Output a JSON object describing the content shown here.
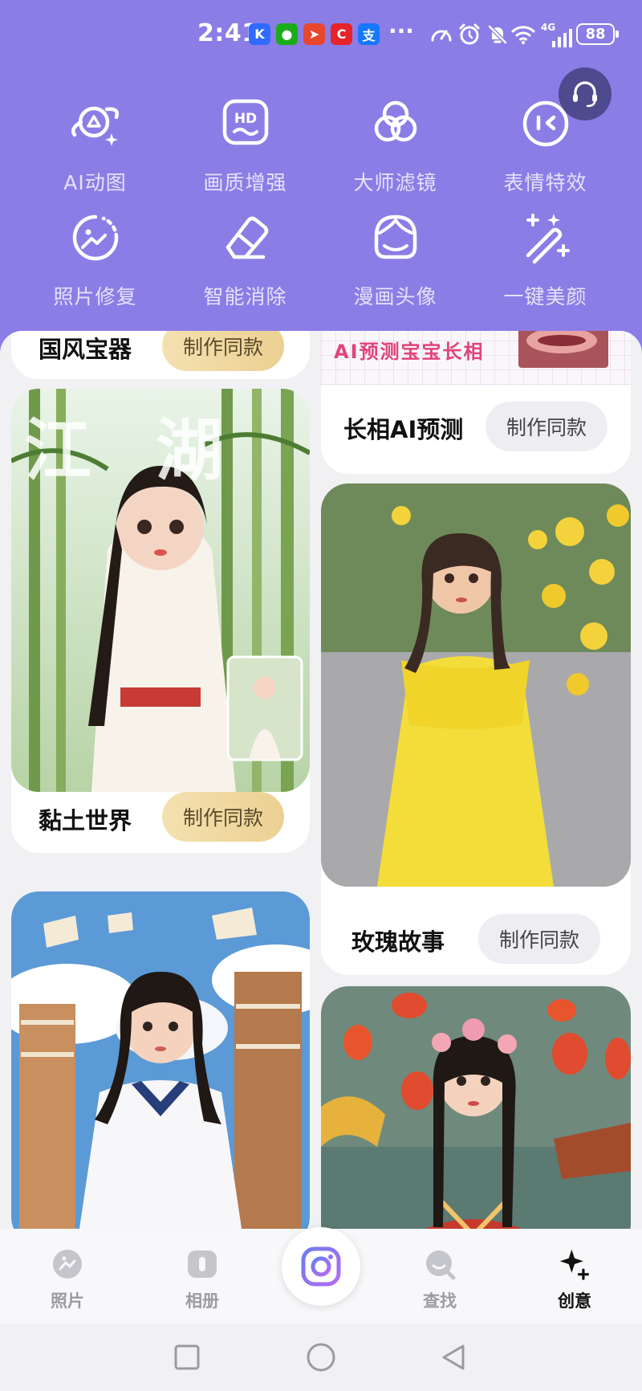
{
  "status_bar": {
    "time": "2:41",
    "network": "4G",
    "battery": "88",
    "more": "···",
    "app_icons": [
      {
        "name": "kuaishou-icon",
        "glyph": "K",
        "color": "#2f6bff"
      },
      {
        "name": "wechat-icon",
        "glyph": "●",
        "color": "#1aad19"
      },
      {
        "name": "telegram-icon",
        "glyph": "➤",
        "color": "#e8462d"
      },
      {
        "name": "app-c-icon",
        "glyph": "C",
        "color": "#e5252a"
      },
      {
        "name": "alipay-icon",
        "glyph": "支",
        "color": "#1677ff"
      }
    ]
  },
  "tools": [
    {
      "label": "AI动图",
      "icon": "planet-sparkle-icon"
    },
    {
      "label": "画质增强",
      "icon": "hd-icon"
    },
    {
      "label": "大师滤镜",
      "icon": "filter-circles-icon"
    },
    {
      "label": "表情特效",
      "icon": "emoji-effect-icon"
    },
    {
      "label": "照片修复",
      "icon": "photo-repair-icon"
    },
    {
      "label": "智能消除",
      "icon": "eraser-icon"
    },
    {
      "label": "漫画头像",
      "icon": "comic-avatar-icon"
    },
    {
      "label": "一键美颜",
      "icon": "magic-wand-icon"
    }
  ],
  "cards": [
    {
      "title": "国风宝器",
      "button": "制作同款"
    },
    {
      "title": "长相AI预测",
      "button": "制作同款",
      "image_text": "AI预测宝宝长相"
    },
    {
      "title": "黏土世界",
      "button": "制作同款",
      "image_text": "江湖"
    },
    {
      "title": "玫瑰故事",
      "button": "制作同款"
    },
    {
      "title": "",
      "button": ""
    },
    {
      "title": "",
      "button": ""
    }
  ],
  "nav": {
    "items": [
      {
        "label": "照片",
        "icon": "photos-icon"
      },
      {
        "label": "相册",
        "icon": "album-icon"
      },
      {
        "label": "查找",
        "icon": "search-icon"
      },
      {
        "label": "创意",
        "icon": "sparkle-icon"
      }
    ],
    "center": "camera-icon",
    "active": "创意"
  },
  "colors": {
    "header": "#8b7de6",
    "gold_button": "#f0d89f",
    "gray_button": "#eeedf2"
  }
}
